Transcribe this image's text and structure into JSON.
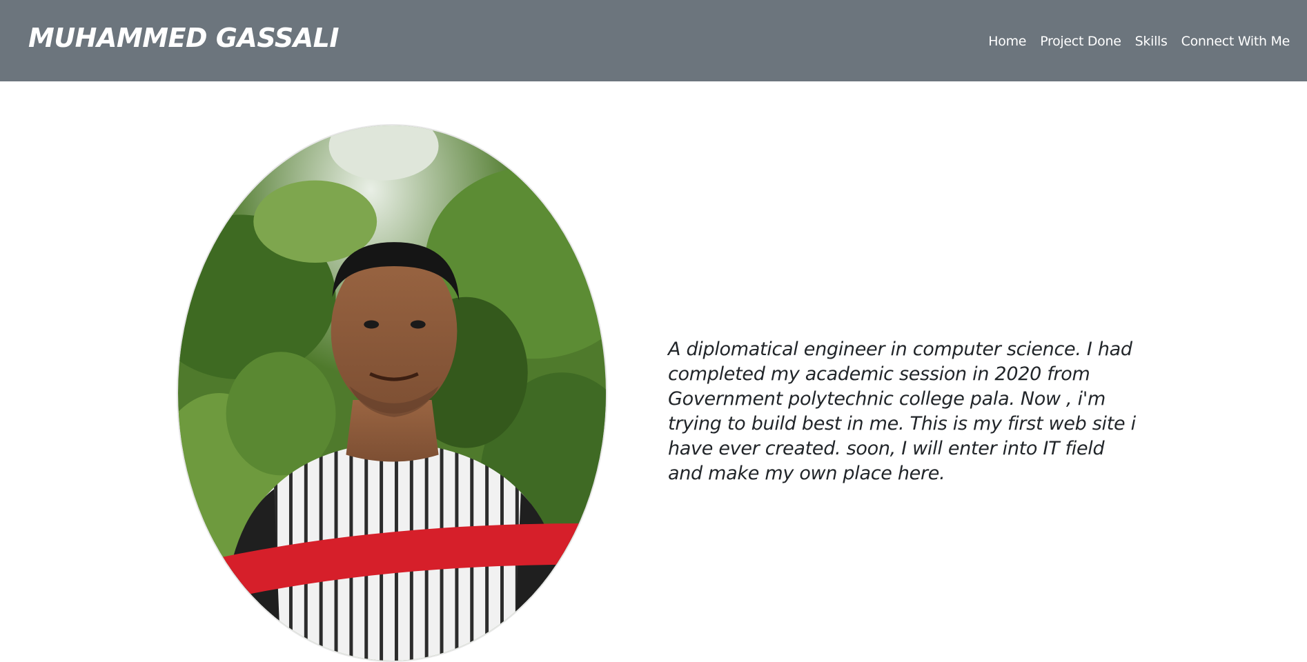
{
  "navbar": {
    "brand": "MUHAMMED GASSALI",
    "links": [
      "Home",
      "Project Done",
      "Skills",
      "Connect With Me"
    ]
  },
  "hero": {
    "photo_icon": "profile-photo",
    "bio": "A diplomatical engineer in computer science. I had completed my academic session in 2020 from Government polytechnic college pala. Now , i'm trying to build best in me. This is my first web site i have ever created. soon, I will enter into IT field and make my own place here."
  },
  "colors": {
    "navbar_bg": "#6c757d",
    "text": "#212529"
  }
}
